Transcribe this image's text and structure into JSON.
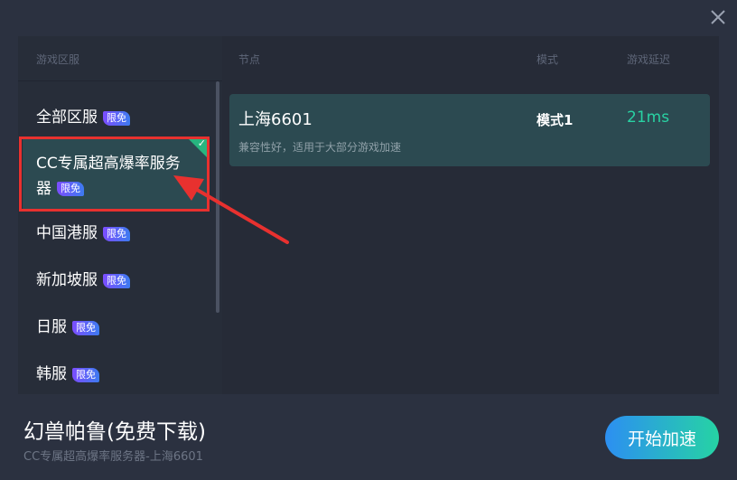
{
  "header": {
    "close_icon": "close-icon"
  },
  "left": {
    "heading": "游戏区服",
    "servers": [
      {
        "name": "全部区服",
        "badge": "限免"
      },
      {
        "name": "CC专属超高爆率服务",
        "name2": "器",
        "badge": "限免",
        "selected": true
      },
      {
        "name": "中国港服",
        "badge": "限免"
      },
      {
        "name": "新加坡服",
        "badge": "限免"
      },
      {
        "name": "日服",
        "badge": "限免"
      },
      {
        "name": "韩服",
        "badge": "限免"
      }
    ]
  },
  "right": {
    "headers": {
      "node": "节点",
      "mode": "模式",
      "latency": "游戏延迟"
    },
    "nodes": [
      {
        "name": "上海6601",
        "desc": "兼容性好，适用于大部分游戏加速",
        "mode": "模式1",
        "latency": "21ms"
      }
    ]
  },
  "footer": {
    "game_title": "幻兽帕鲁(免费下载)",
    "subtitle": "CC专属超高爆率服务器-上海6601",
    "start_label": "开始加速"
  },
  "colors": {
    "background": "#2b3140",
    "selected_row": "#2c4a51",
    "latency_green": "#29d2a3",
    "highlight_red": "#e8312f"
  }
}
